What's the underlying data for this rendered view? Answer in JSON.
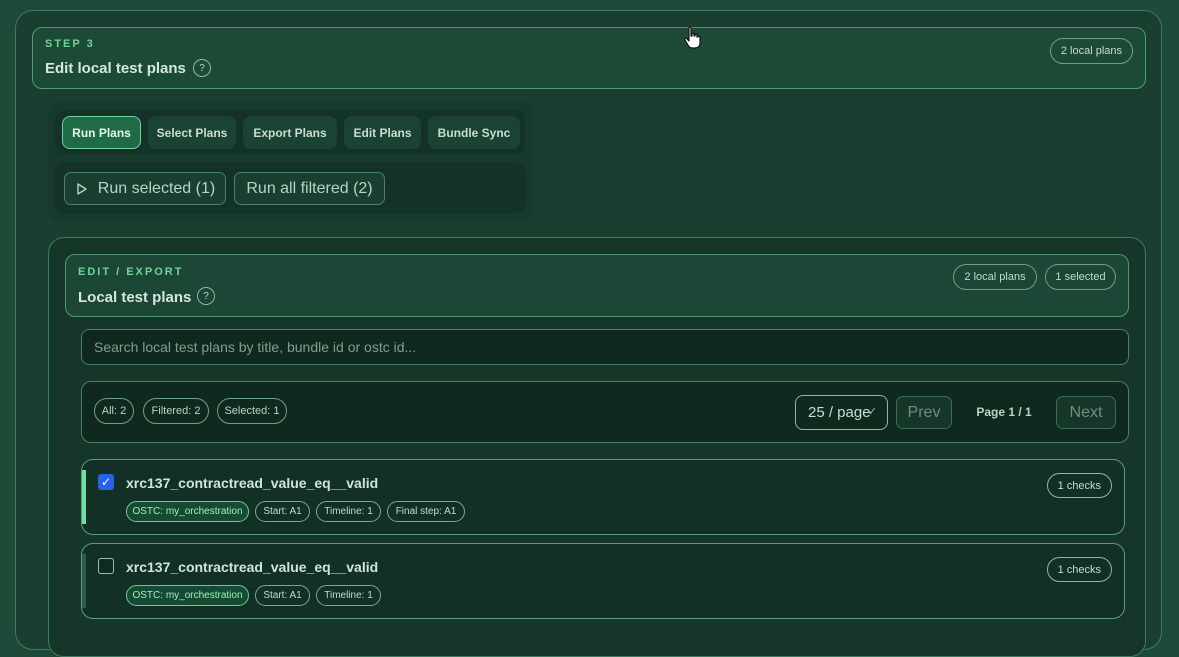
{
  "step": {
    "eyebrow": "STEP 3",
    "title": "Edit local test plans",
    "help": "?",
    "badge": "2 local plans"
  },
  "tabs": [
    {
      "label": "Run Plans",
      "active": true
    },
    {
      "label": "Select Plans",
      "active": false
    },
    {
      "label": "Export Plans",
      "active": false
    },
    {
      "label": "Edit Plans",
      "active": false
    },
    {
      "label": "Bundle Sync",
      "active": false
    }
  ],
  "actions": {
    "run_selected": "Run selected (1)",
    "run_all": "Run all filtered (2)",
    "play_icon": "play-icon"
  },
  "edit": {
    "eyebrow": "EDIT / EXPORT",
    "title": "Local test plans",
    "help": "?",
    "badges": [
      "2 local plans",
      "1 selected"
    ]
  },
  "search": {
    "placeholder": "Search local test plans by title, bundle id or ostc id...",
    "value": ""
  },
  "filters": {
    "chips": [
      "All: 2",
      "Filtered: 2",
      "Selected: 1"
    ],
    "page_size": "25 / page",
    "prev": "Prev",
    "page_info": "Page 1 / 1",
    "next": "Next"
  },
  "plans": [
    {
      "title": "xrc137_contractread_value_eq__valid",
      "selected": true,
      "checks": "1 checks",
      "tags": [
        "OSTC: my_orchestration",
        "Start: A1",
        "Timeline: 1",
        "Final step: A1"
      ]
    },
    {
      "title": "xrc137_contractread_value_eq__valid",
      "selected": false,
      "checks": "1 checks",
      "tags": [
        "OSTC: my_orchestration",
        "Start: A1",
        "Timeline: 1"
      ]
    }
  ],
  "colors": {
    "accent": "#6fd49b",
    "checkbox": "#2563eb",
    "background": "#1e4a39"
  }
}
